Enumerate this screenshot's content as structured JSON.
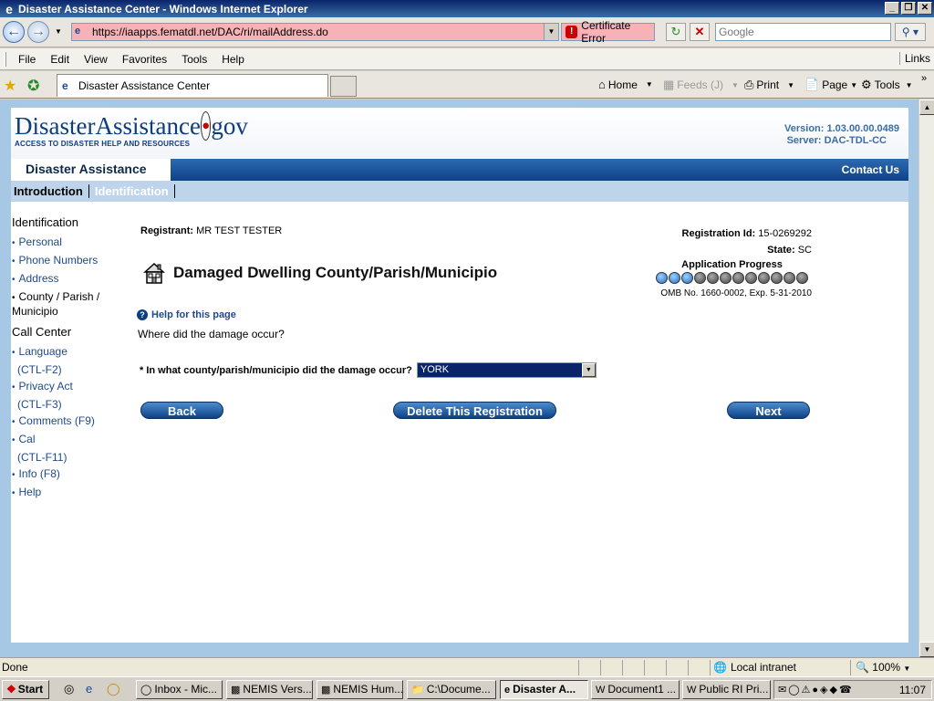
{
  "window": {
    "title": "Disaster Assistance Center - Windows Internet Explorer",
    "controls": [
      "_",
      "❐",
      "✕"
    ]
  },
  "addressbar": {
    "url": "https://iaapps.fematdl.net/DAC/ri/mailAddress.do",
    "cert_error": "Certificate Error",
    "search_placeholder": "Google"
  },
  "menu": {
    "items": [
      "File",
      "Edit",
      "View",
      "Favorites",
      "Tools",
      "Help"
    ],
    "links": "Links"
  },
  "tabs": {
    "active_tab": "Disaster Assistance Center",
    "commands": {
      "home": "Home",
      "feeds": "Feeds (J)",
      "print": "Print",
      "page": "Page",
      "tools": "Tools"
    }
  },
  "site": {
    "brand_main": "DisasterAssistance",
    "brand_dot": "•",
    "brand_tld": "gov",
    "tagline": "ACCESS TO DISASTER HELP AND RESOURCES",
    "version": "Version: 1.03.00.00.0489",
    "server": "Server: DAC-TDL-CC",
    "section_title": "Disaster Assistance",
    "contact": "Contact Us",
    "subnav": [
      "Introduction",
      "Identification"
    ]
  },
  "sidebar": {
    "identification_heading": "Identification",
    "identification_items": [
      "Personal",
      "Phone Numbers",
      "Address"
    ],
    "active_item_line1": "County / Parish /",
    "active_item_line2": "Municipio",
    "callcenter_heading": "Call Center",
    "language": "Language",
    "language_key": "(CTL-F2)",
    "privacy": "Privacy Act",
    "privacy_key": "(CTL-F3)",
    "comments": "Comments (F9)",
    "cal": "Cal",
    "cal_key": "(CTL-F11)",
    "info": "Info (F8)",
    "help": "Help"
  },
  "main": {
    "registrant_label": "Registrant:",
    "registrant_value": "MR TEST TESTER",
    "regid_label": "Registration Id:",
    "regid_value": "15-0269292",
    "state_label": "State:",
    "state_value": "SC",
    "page_title": "Damaged Dwelling County/Parish/Municipio",
    "progress_label": "Application Progress",
    "progress": {
      "completed": 3,
      "total": 12
    },
    "omb": "OMB No. 1660-0002, Exp. 5-31-2010",
    "help_link": "Help for this page",
    "where": "Where did the damage occur?",
    "question": "* In what county/parish/municipio did the damage occur?",
    "selected_county": "YORK",
    "back": "Back",
    "delete": "Delete This Registration",
    "next": "Next"
  },
  "status": {
    "text": "Done",
    "zone": "Local intranet",
    "zoom": "100%"
  },
  "taskbar": {
    "start": "Start",
    "tasks": [
      "Inbox - Mic...",
      "NEMIS Vers...",
      "NEMIS Hum...",
      "C:\\Docume...",
      "Disaster A...",
      "Document1 ...",
      "Public RI Pri..."
    ],
    "clock": "11:07"
  }
}
